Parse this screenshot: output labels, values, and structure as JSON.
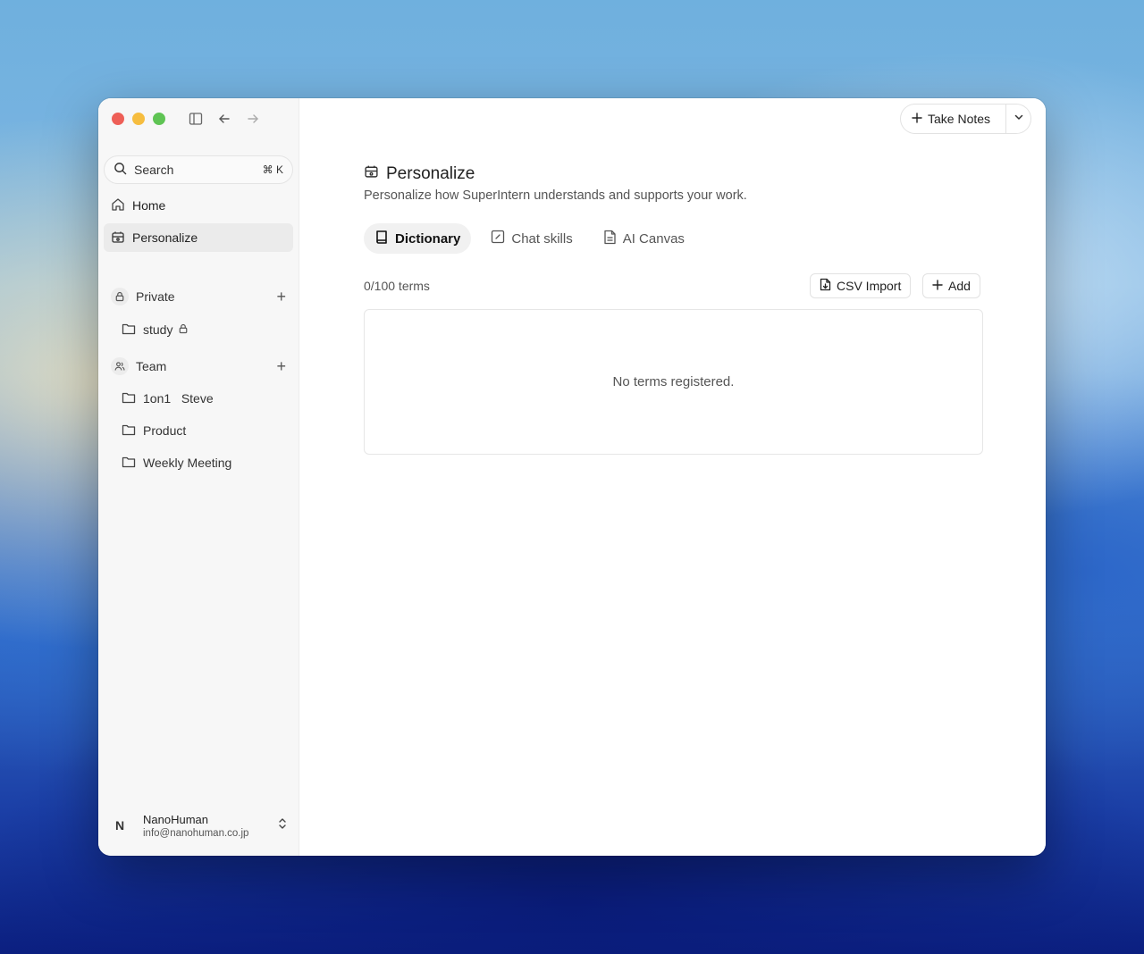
{
  "window": {
    "traffic_lights": {
      "close": "#ee5f57",
      "minimize": "#f6bd3f",
      "maximize": "#5fc454"
    }
  },
  "sidebar": {
    "search": {
      "label": "Search",
      "shortcut": "⌘ K"
    },
    "nav": [
      {
        "label": "Home",
        "icon": "home-icon",
        "active": false
      },
      {
        "label": "Personalize",
        "icon": "personalize-icon",
        "active": true
      }
    ],
    "sections": [
      {
        "label": "Private",
        "icon": "lock-icon",
        "folders": [
          {
            "label": "study",
            "locked": true
          }
        ]
      },
      {
        "label": "Team",
        "icon": "team-icon",
        "folders": [
          {
            "label": "1on1   Steve"
          },
          {
            "label": "Product"
          },
          {
            "label": "Weekly Meeting"
          }
        ]
      }
    ],
    "user": {
      "initial": "N",
      "name": "NanoHuman",
      "email": "info@nanohuman.co.jp"
    }
  },
  "header": {
    "take_notes_label": "Take Notes"
  },
  "main": {
    "title": "Personalize",
    "description": "Personalize how SuperIntern understands and supports your work.",
    "tabs": [
      {
        "label": "Dictionary",
        "icon": "book-icon",
        "active": true
      },
      {
        "label": "Chat skills",
        "icon": "skill-icon",
        "active": false
      },
      {
        "label": "AI Canvas",
        "icon": "document-icon",
        "active": false
      }
    ],
    "terms_count": "0/100 terms",
    "csv_import_label": "CSV Import",
    "add_label": "Add",
    "empty_message": "No terms registered."
  }
}
